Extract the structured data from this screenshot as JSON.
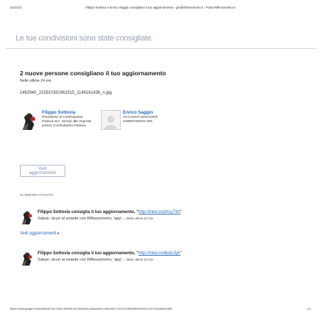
{
  "print_header": {
    "date": "22/11/13",
    "title": "Filippo Sottovia e Enrico Saggin consigliano il tuo aggiornamento - gio@riflessometro.it - Posta Riflessometro.it"
  },
  "banner": "Le tue condivisioni sono state consigliate",
  "recommendation": {
    "headline": "2 nuove persone consigliano il tuo aggiornamento",
    "subtext": "Nelle ultime 24 ore",
    "filename": "1462940_215510331961515_1148161436_n.jpg"
  },
  "people": [
    {
      "name": "Filippo Sottovia",
      "lines": [
        "Presidente di Confindustria",
        "Padova sez. Servizi alle Imprese",
        "presso Confindustria Padova"
      ]
    },
    {
      "name": "Enrico Saggin",
      "lines": [
        "ACCOUNT MANAGER",
        "UNIBROKERS SRL"
      ]
    }
  ],
  "see_updates_button": "Vedi aggiornamenti",
  "section_label": "ULTERIORI ATTIVITÀ",
  "activities": [
    {
      "actor_text": "Filippo Sottovia consiglia il tuo aggiornamento, \"",
      "link": "http://lnkd.in/dXxyT9X",
      "close_quote": "\"",
      "body": "Salute: sicuri al volante con Riflessometro, 'app'...",
      "time": "Nelle ultime 24 ore"
    },
    {
      "actor_text": "Filippo Sottovia consiglia il tuo aggiornamento, \"",
      "link": "http://lnkd.in/dbxDJyK",
      "close_quote": "\"",
      "body": "Salute: sicuri al volante con Riflessometro, 'app'...",
      "time": "Nelle ultime 24 ore"
    }
  ],
  "more_updates_link": "Vedi aggiornamenti ▸",
  "print_footer": {
    "url": "https://mail.google.com/mail/u/0/?ui=2&ik=1ff4bce14278&view=pt&search=inbox&th=1427c12455482fa4%3C1427c16c4a591589",
    "page": "1/1"
  }
}
